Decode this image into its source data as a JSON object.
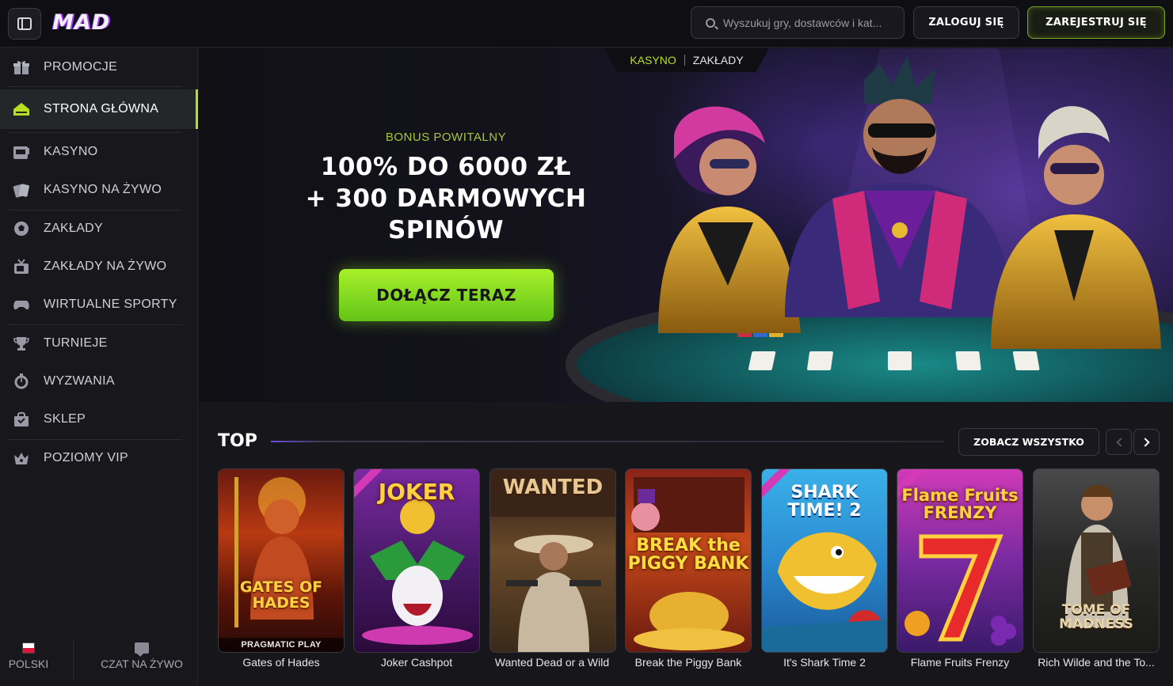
{
  "header": {
    "logo": "MAD",
    "search_placeholder": "Wyszukuj gry, dostawców i kat...",
    "login_label": "ZALOGUJ SIĘ",
    "register_label": "ZAREJESTRUJ SIĘ"
  },
  "sidebar": {
    "items": [
      {
        "label": "PROMOCJE",
        "icon": "gift-icon"
      },
      {
        "label": "STRONA GŁÓWNA",
        "icon": "home-icon",
        "active": true
      },
      {
        "label": "KASYNO",
        "icon": "slot-machine-icon"
      },
      {
        "label": "KASYNO NA ŻYWO",
        "icon": "cards-icon"
      },
      {
        "label": "ZAKŁADY",
        "icon": "soccer-ball-icon"
      },
      {
        "label": "ZAKŁADY NA ŻYWO",
        "icon": "tv-icon"
      },
      {
        "label": "WIRTUALNE SPORTY",
        "icon": "gamepad-icon"
      },
      {
        "label": "TURNIEJE",
        "icon": "trophy-icon"
      },
      {
        "label": "WYZWANIA",
        "icon": "stopwatch-icon"
      },
      {
        "label": "SKLEP",
        "icon": "shopping-bag-icon"
      },
      {
        "label": "POZIOMY VIP",
        "icon": "crown-icon"
      }
    ],
    "language": "POLSKI",
    "live_chat": "CZAT NA ŻYWO"
  },
  "hero": {
    "tab_casino": "KASYNO",
    "tab_sports": "ZAKŁADY",
    "bonus_label": "BONUS POWITALNY",
    "bonus_line1": "100% DO 6000 ZŁ",
    "bonus_line2": "+ 300 DARMOWYCH",
    "bonus_line3": "SPINÓW",
    "cta": "DOŁĄCZ TERAZ"
  },
  "top": {
    "title": "TOP",
    "see_all": "ZOBACZ WSZYSTKO",
    "games": [
      {
        "name": "Gates of Hades",
        "art_text": "GATES OF HADES",
        "provider": "PRAGMATIC PLAY"
      },
      {
        "name": "Joker Cashpot",
        "art_text": "JOKER",
        "provider": ""
      },
      {
        "name": "Wanted Dead or a Wild",
        "art_text": "WANTED",
        "provider": ""
      },
      {
        "name": "Break the Piggy Bank",
        "art_text": "BREAK the PIGGY BANK",
        "provider": ""
      },
      {
        "name": "It's Shark Time 2",
        "art_text": "SHARK TIME! 2",
        "provider": ""
      },
      {
        "name": "Flame Fruits Frenzy",
        "art_text": "Flame Fruits FRENZY",
        "provider": ""
      },
      {
        "name": "Rich Wilde and the To...",
        "art_text": "TOME OF MADNESS",
        "provider": ""
      }
    ]
  },
  "colors": {
    "accent": "#b8e020",
    "cta_gradient_top": "#a8f02a",
    "cta_gradient_bottom": "#63c418",
    "background": "#16161b"
  }
}
